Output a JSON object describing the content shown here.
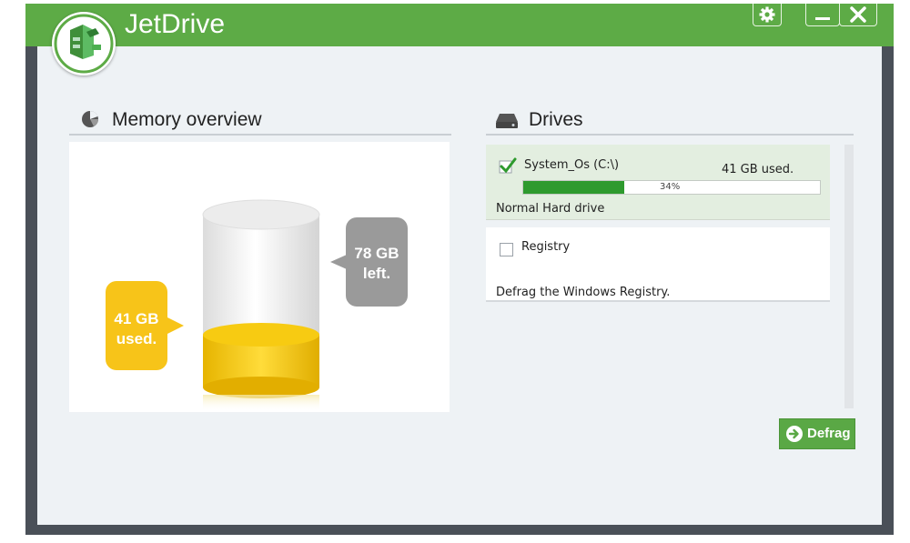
{
  "app": {
    "title": "JetDrive"
  },
  "colors": {
    "brand_green": "#5dab46",
    "used_yellow": "#f2c400",
    "free_gray": "#9a9a9a",
    "progress_green": "#2e9a2e"
  },
  "icons": {
    "logo": "jetdrive-logo-icon",
    "settings": "gear-icon",
    "minimize": "minimize-icon",
    "close": "close-icon",
    "memory": "pie-chart-icon",
    "drives": "hard-drive-icon",
    "defrag": "arrow-right-circle-icon",
    "checkmark": "checkmark-icon"
  },
  "memory_overview": {
    "title": "Memory overview",
    "used_label_line1": "41 GB",
    "used_label_line2": "used.",
    "free_label_line1": "78 GB",
    "free_label_line2": "left.",
    "used_gb": 41,
    "free_gb": 78
  },
  "drives": {
    "title": "Drives",
    "items": [
      {
        "name": "System_Os (C:\\)",
        "checked": true,
        "used_text": "41 GB used.",
        "progress_text": "34%",
        "progress_fraction": 0.34,
        "description": "Normal Hard drive"
      },
      {
        "name": "Registry",
        "checked": false,
        "description": "Defrag the Windows Registry."
      }
    ]
  },
  "defrag_button": {
    "label": "Defrag"
  }
}
